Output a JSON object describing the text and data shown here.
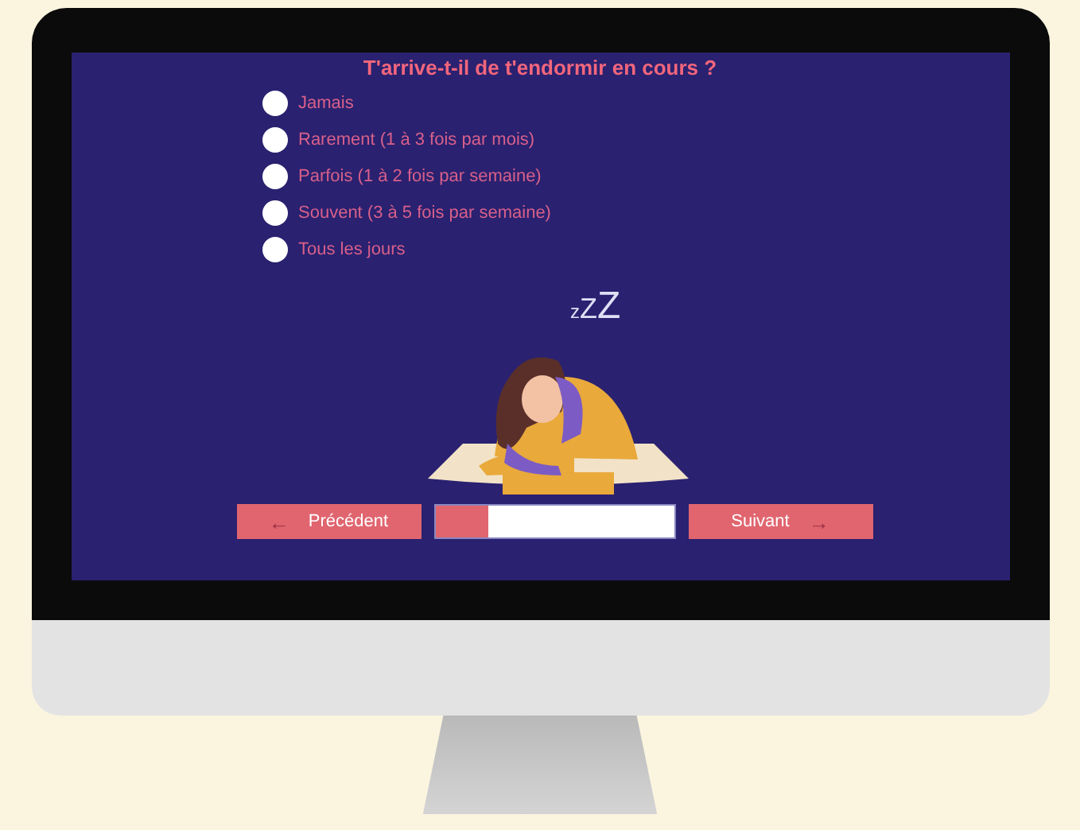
{
  "question": "T'arrive-t-il de t'endormir en cours ?",
  "options": [
    {
      "label": "Jamais",
      "selected": false
    },
    {
      "label": "Rarement (1 à 3 fois par mois)",
      "selected": false
    },
    {
      "label": "Parfois (1 à 2 fois par semaine)",
      "selected": false
    },
    {
      "label": "Souvent (3 à 5 fois par semaine)",
      "selected": false
    },
    {
      "label": "Tous les jours",
      "selected": false
    }
  ],
  "sleep_mark": "zZZ",
  "previous_button": {
    "arrow": "←",
    "label": "Précédent"
  },
  "progress": {
    "level": 0.22
  },
  "next_button": {
    "label": "Suivant",
    "arrow": "→"
  }
}
